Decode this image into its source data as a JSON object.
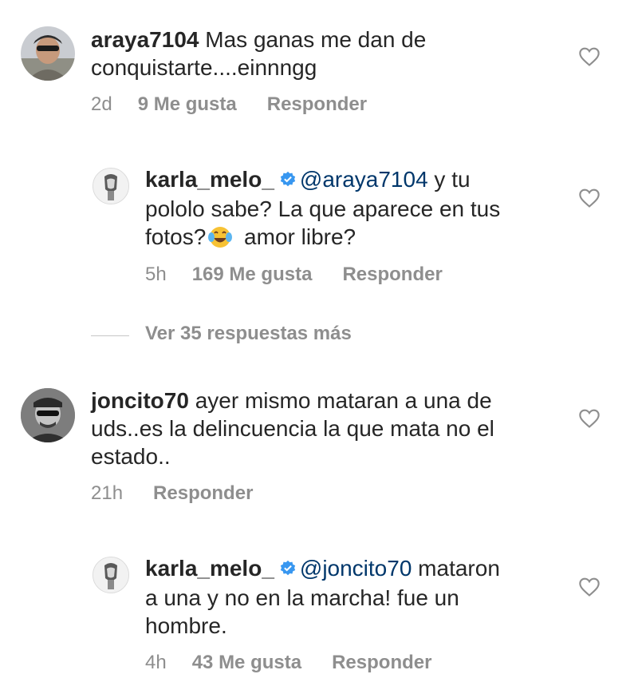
{
  "comments": [
    {
      "username": "araya7104",
      "text_lines": [
        "Mas ganas me dan de",
        "conquistarte....einnngg"
      ],
      "time": "2d",
      "likes": "9 Me gusta",
      "reply_label": "Responder"
    },
    {
      "username": "karla_melo_",
      "mention": "@araya7104",
      "line1_rest": " y tu",
      "line2": "pololo sabe? La que aparece en tus",
      "line3_a": "fotos?",
      "emoji": "face-with-tears-of-joy",
      "line3_b": " amor libre?",
      "time": "5h",
      "likes": "169 Me gusta",
      "reply_label": "Responder"
    },
    {
      "more_replies": "Ver 35 respuestas más"
    },
    {
      "username": "joncito70",
      "line1_rest": " ayer mismo mataran a una de",
      "line2": "uds..es la delincuencia la que mata no el",
      "line3": "estado..",
      "time": "21h",
      "reply_label": "Responder"
    },
    {
      "username": "karla_melo_",
      "mention": "@joncito70",
      "line1_rest": " mataron",
      "line2": "a una y no en la marcha! fue un",
      "line3": "hombre.",
      "time": "4h",
      "likes": "43 Me gusta",
      "reply_label": "Responder"
    }
  ],
  "colors": {
    "text": "#262626",
    "secondary": "#8e8e8e",
    "mention": "#00376b",
    "verified": "#3897f0"
  },
  "icons": [
    "heart-outline-icon",
    "verified-badge-icon",
    "face-with-tears-of-joy-emoji"
  ]
}
